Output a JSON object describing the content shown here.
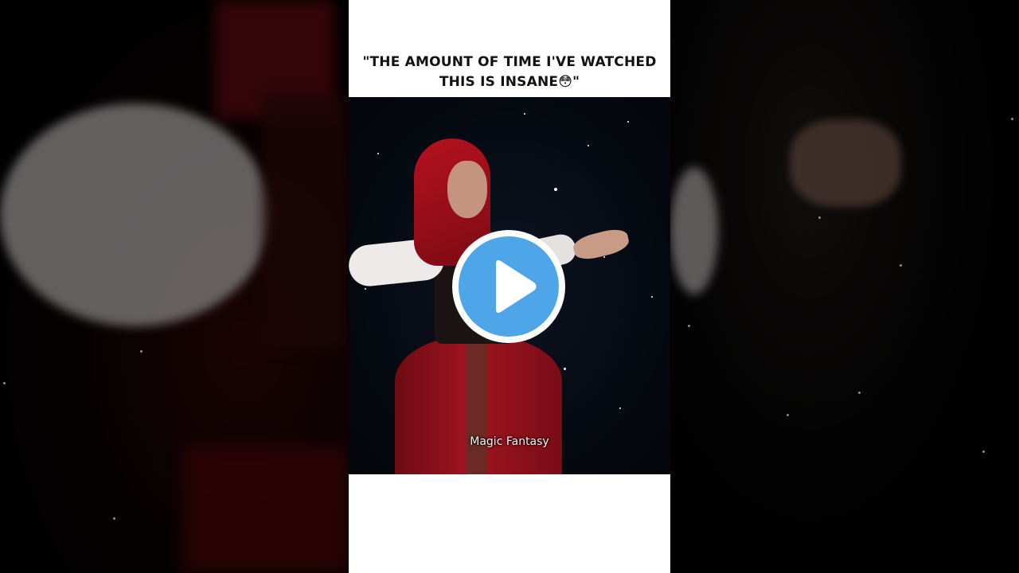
{
  "post": {
    "caption_line1": "\"THE AMOUNT OF TIME I'VE WATCHED",
    "caption_line2": "THIS IS INSANE😳\""
  },
  "video": {
    "subtitle": "Magic Fantasy",
    "play_icon": "play-icon"
  },
  "colors": {
    "play_accent": "#4ea5e8",
    "card_background": "#ffffff",
    "costume_red": "#9e1522"
  }
}
